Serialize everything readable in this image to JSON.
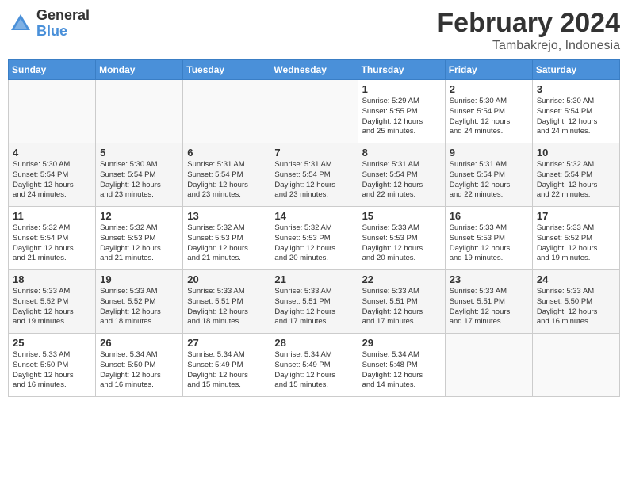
{
  "header": {
    "logo_general": "General",
    "logo_blue": "Blue",
    "month_title": "February 2024",
    "location": "Tambakrejo, Indonesia"
  },
  "days_of_week": [
    "Sunday",
    "Monday",
    "Tuesday",
    "Wednesday",
    "Thursday",
    "Friday",
    "Saturday"
  ],
  "weeks": [
    [
      {
        "day": "",
        "info": ""
      },
      {
        "day": "",
        "info": ""
      },
      {
        "day": "",
        "info": ""
      },
      {
        "day": "",
        "info": ""
      },
      {
        "day": "1",
        "info": "Sunrise: 5:29 AM\nSunset: 5:55 PM\nDaylight: 12 hours\nand 25 minutes."
      },
      {
        "day": "2",
        "info": "Sunrise: 5:30 AM\nSunset: 5:54 PM\nDaylight: 12 hours\nand 24 minutes."
      },
      {
        "day": "3",
        "info": "Sunrise: 5:30 AM\nSunset: 5:54 PM\nDaylight: 12 hours\nand 24 minutes."
      }
    ],
    [
      {
        "day": "4",
        "info": "Sunrise: 5:30 AM\nSunset: 5:54 PM\nDaylight: 12 hours\nand 24 minutes."
      },
      {
        "day": "5",
        "info": "Sunrise: 5:30 AM\nSunset: 5:54 PM\nDaylight: 12 hours\nand 23 minutes."
      },
      {
        "day": "6",
        "info": "Sunrise: 5:31 AM\nSunset: 5:54 PM\nDaylight: 12 hours\nand 23 minutes."
      },
      {
        "day": "7",
        "info": "Sunrise: 5:31 AM\nSunset: 5:54 PM\nDaylight: 12 hours\nand 23 minutes."
      },
      {
        "day": "8",
        "info": "Sunrise: 5:31 AM\nSunset: 5:54 PM\nDaylight: 12 hours\nand 22 minutes."
      },
      {
        "day": "9",
        "info": "Sunrise: 5:31 AM\nSunset: 5:54 PM\nDaylight: 12 hours\nand 22 minutes."
      },
      {
        "day": "10",
        "info": "Sunrise: 5:32 AM\nSunset: 5:54 PM\nDaylight: 12 hours\nand 22 minutes."
      }
    ],
    [
      {
        "day": "11",
        "info": "Sunrise: 5:32 AM\nSunset: 5:54 PM\nDaylight: 12 hours\nand 21 minutes."
      },
      {
        "day": "12",
        "info": "Sunrise: 5:32 AM\nSunset: 5:53 PM\nDaylight: 12 hours\nand 21 minutes."
      },
      {
        "day": "13",
        "info": "Sunrise: 5:32 AM\nSunset: 5:53 PM\nDaylight: 12 hours\nand 21 minutes."
      },
      {
        "day": "14",
        "info": "Sunrise: 5:32 AM\nSunset: 5:53 PM\nDaylight: 12 hours\nand 20 minutes."
      },
      {
        "day": "15",
        "info": "Sunrise: 5:33 AM\nSunset: 5:53 PM\nDaylight: 12 hours\nand 20 minutes."
      },
      {
        "day": "16",
        "info": "Sunrise: 5:33 AM\nSunset: 5:53 PM\nDaylight: 12 hours\nand 19 minutes."
      },
      {
        "day": "17",
        "info": "Sunrise: 5:33 AM\nSunset: 5:52 PM\nDaylight: 12 hours\nand 19 minutes."
      }
    ],
    [
      {
        "day": "18",
        "info": "Sunrise: 5:33 AM\nSunset: 5:52 PM\nDaylight: 12 hours\nand 19 minutes."
      },
      {
        "day": "19",
        "info": "Sunrise: 5:33 AM\nSunset: 5:52 PM\nDaylight: 12 hours\nand 18 minutes."
      },
      {
        "day": "20",
        "info": "Sunrise: 5:33 AM\nSunset: 5:51 PM\nDaylight: 12 hours\nand 18 minutes."
      },
      {
        "day": "21",
        "info": "Sunrise: 5:33 AM\nSunset: 5:51 PM\nDaylight: 12 hours\nand 17 minutes."
      },
      {
        "day": "22",
        "info": "Sunrise: 5:33 AM\nSunset: 5:51 PM\nDaylight: 12 hours\nand 17 minutes."
      },
      {
        "day": "23",
        "info": "Sunrise: 5:33 AM\nSunset: 5:51 PM\nDaylight: 12 hours\nand 17 minutes."
      },
      {
        "day": "24",
        "info": "Sunrise: 5:33 AM\nSunset: 5:50 PM\nDaylight: 12 hours\nand 16 minutes."
      }
    ],
    [
      {
        "day": "25",
        "info": "Sunrise: 5:33 AM\nSunset: 5:50 PM\nDaylight: 12 hours\nand 16 minutes."
      },
      {
        "day": "26",
        "info": "Sunrise: 5:34 AM\nSunset: 5:50 PM\nDaylight: 12 hours\nand 16 minutes."
      },
      {
        "day": "27",
        "info": "Sunrise: 5:34 AM\nSunset: 5:49 PM\nDaylight: 12 hours\nand 15 minutes."
      },
      {
        "day": "28",
        "info": "Sunrise: 5:34 AM\nSunset: 5:49 PM\nDaylight: 12 hours\nand 15 minutes."
      },
      {
        "day": "29",
        "info": "Sunrise: 5:34 AM\nSunset: 5:48 PM\nDaylight: 12 hours\nand 14 minutes."
      },
      {
        "day": "",
        "info": ""
      },
      {
        "day": "",
        "info": ""
      }
    ]
  ]
}
